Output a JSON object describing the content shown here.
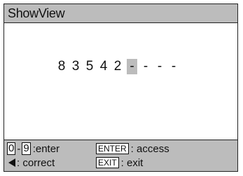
{
  "title": "ShowView",
  "code_digits": [
    "8",
    "3",
    "5",
    "4",
    "2"
  ],
  "cursor_value": "-",
  "remaining_slots": [
    "-",
    "-",
    "-"
  ],
  "help": {
    "range_start_key": "0",
    "range_separator": "-",
    "range_end_key": "9",
    "enter_text": ":enter",
    "enter_key": "ENTER",
    "access_text": ": access",
    "back_icon": "left-arrow-icon",
    "correct_text": ": correct",
    "exit_key": "EXIT",
    "exit_text": ": exit"
  },
  "colors": {
    "bar_gray": "#bcbcbc",
    "border": "#222222",
    "background": "#ffffff"
  }
}
